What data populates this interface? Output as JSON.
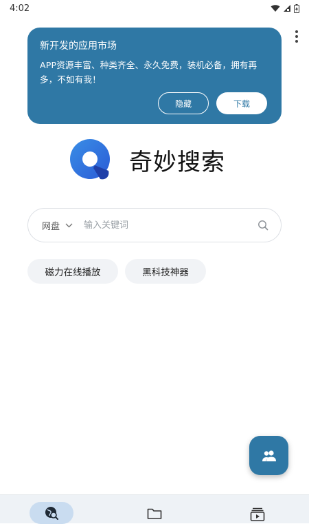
{
  "status_bar": {
    "time": "4:02"
  },
  "banner": {
    "title": "新开发的应用市场",
    "text": "APP资源丰富、种类齐全、永久免费，装机必备，拥有再多，不如有我！",
    "hide_label": "隐藏",
    "download_label": "下载"
  },
  "brand": {
    "name": "奇妙搜索"
  },
  "search": {
    "scope": "网盘",
    "placeholder": "输入关键词"
  },
  "chips": [
    {
      "label": "磁力在线播放"
    },
    {
      "label": "黑科技神器"
    }
  ],
  "colors": {
    "accent": "#2f78a5",
    "nav_background": "#eef2f6",
    "nav_active_pill": "#c9dcf0"
  },
  "icons": {
    "fab": "people-icon",
    "nav": [
      "search-globe-icon",
      "folder-icon",
      "video-library-icon"
    ]
  }
}
